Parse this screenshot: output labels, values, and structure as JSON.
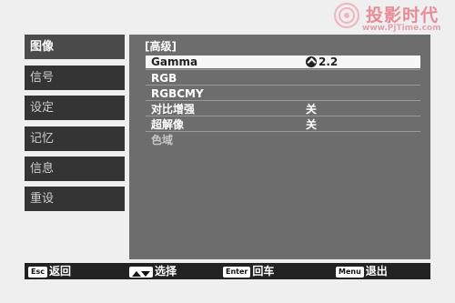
{
  "watermark": {
    "title": "投影时代",
    "url": "www.PjTime.com"
  },
  "left_menu": {
    "items": [
      "图像",
      "信号",
      "设定",
      "记忆",
      "信息",
      "重设"
    ],
    "active_index": 0
  },
  "panel": {
    "header": "[高级]",
    "rows": [
      {
        "label": "Gamma",
        "value": "2.2",
        "state": "selected",
        "value_icon": "gamma-icon"
      },
      {
        "label": "RGB",
        "value": ""
      },
      {
        "label": "RGBCMY",
        "value": ""
      },
      {
        "label": "对比增强",
        "value": "关"
      },
      {
        "label": "超解像",
        "value": "关"
      },
      {
        "label": "色域",
        "value": "",
        "state": "dim"
      }
    ]
  },
  "bottom_hints": [
    {
      "key": "Esc",
      "label": "返回"
    },
    {
      "key": "updown",
      "label": "选择"
    },
    {
      "key": "Enter",
      "label": "回车"
    },
    {
      "key": "Menu",
      "label": "退出"
    }
  ]
}
